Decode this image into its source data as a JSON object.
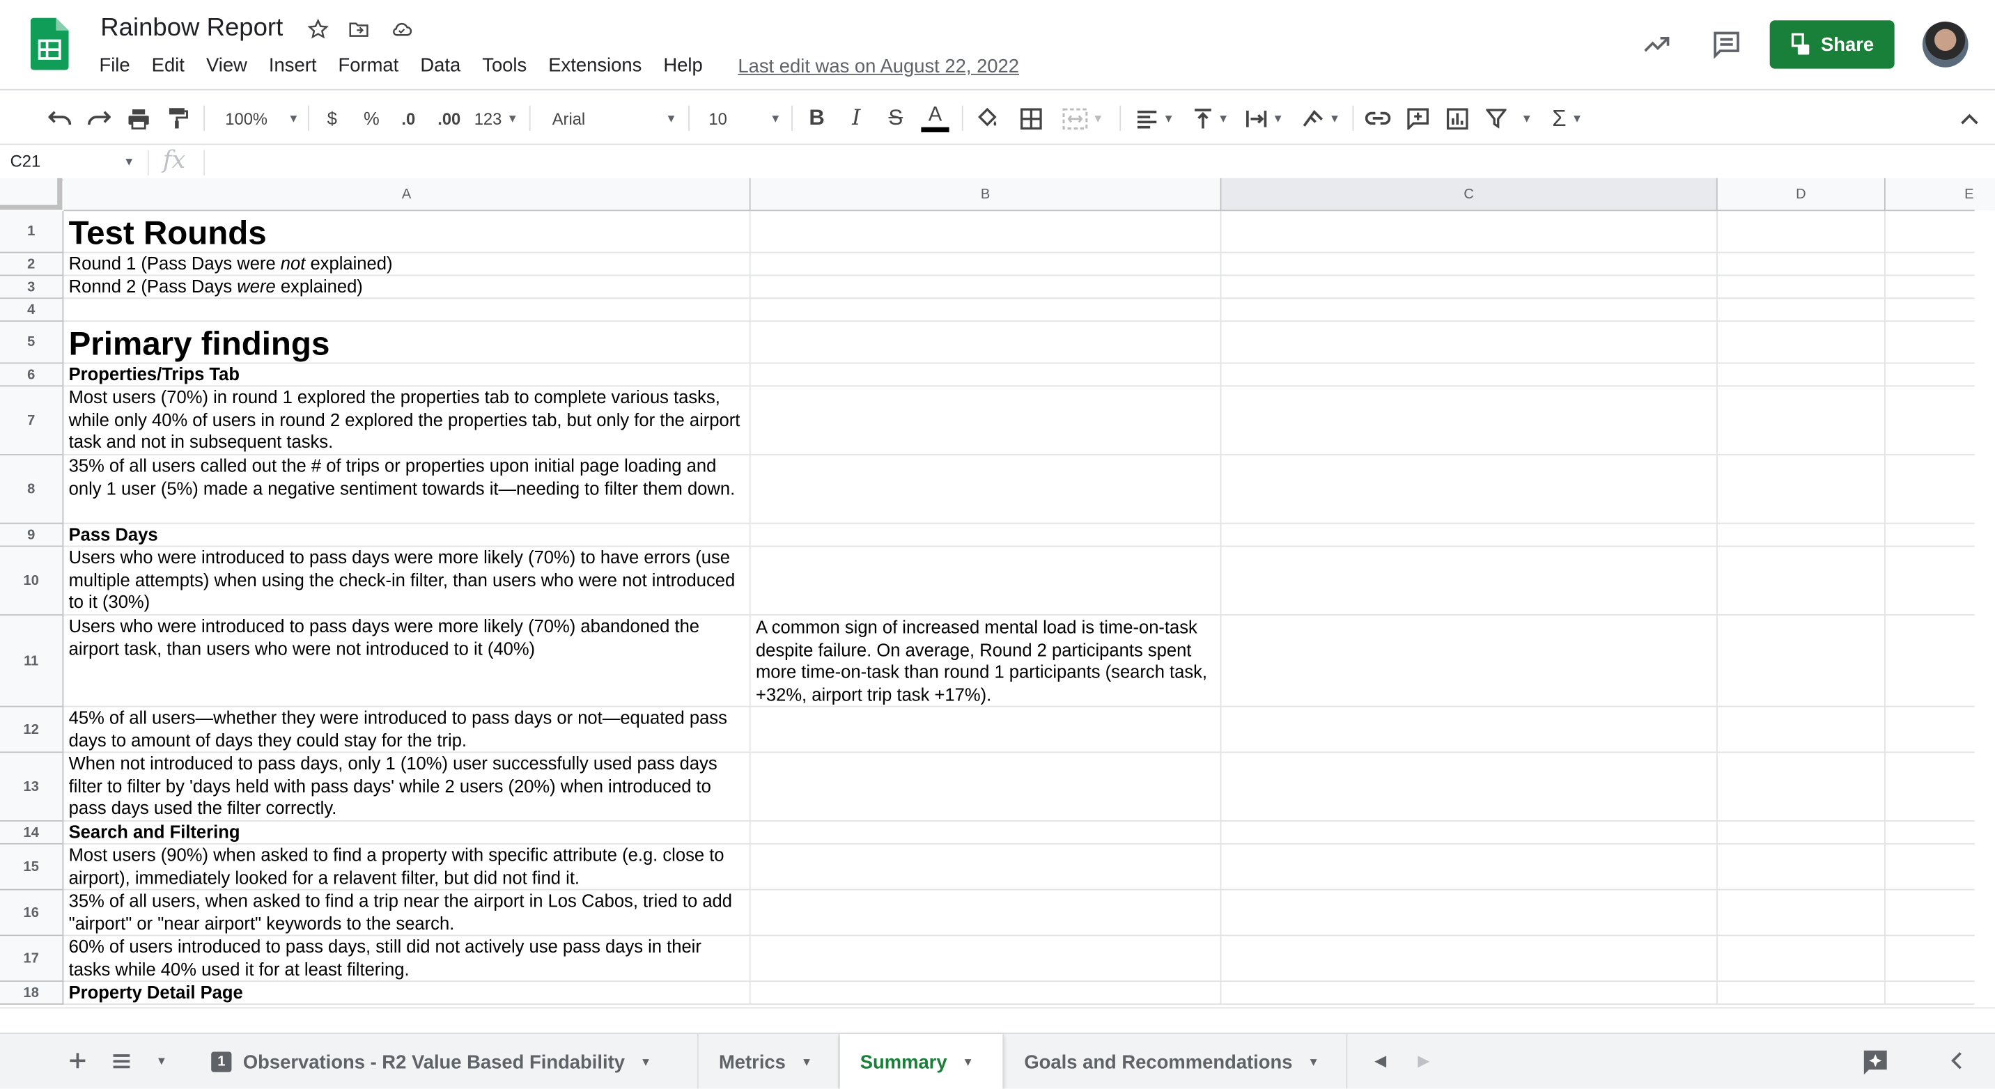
{
  "app": {
    "title": "Rainbow Report",
    "last_edit": "Last edit was on August 22, 2022",
    "share_label": "Share",
    "menu": [
      "File",
      "Edit",
      "View",
      "Insert",
      "Format",
      "Data",
      "Tools",
      "Extensions",
      "Help"
    ]
  },
  "toolbar": {
    "zoom": "100%",
    "currency": "$",
    "percent": "%",
    "dec_decrease": ".0",
    "dec_increase": ".00",
    "more_formats": "123",
    "font": "Arial",
    "font_size": "10",
    "text_color": "#000000"
  },
  "formula_bar": {
    "name_box": "C21",
    "fx": "fx",
    "formula": ""
  },
  "columns": [
    "A",
    "B",
    "C",
    "D",
    "E"
  ],
  "rows": [
    {
      "n": "1",
      "a": "Test Rounds",
      "style": "h1"
    },
    {
      "n": "2",
      "a_parts": [
        "Round 1 (Pass Days were ",
        "not",
        " explained)"
      ]
    },
    {
      "n": "3",
      "a_parts": [
        "Ronnd 2 (Pass Days ",
        "were",
        " explained)"
      ]
    },
    {
      "n": "4",
      "a": ""
    },
    {
      "n": "5",
      "a": "Primary findings",
      "style": "h1"
    },
    {
      "n": "6",
      "a": "Properties/Trips Tab",
      "style": "bold"
    },
    {
      "n": "7",
      "a": "Most users (70%) in round 1 explored the properties tab to complete various tasks, while only 40% of users in round 2 explored the properties tab, but only for the airport task and not in subsequent tasks."
    },
    {
      "n": "8",
      "a": "35% of all users called out the # of trips or properties upon initial page loading and only 1 user (5%) made a negative sentiment towards it—needing to filter them down."
    },
    {
      "n": "9",
      "a": "Pass Days",
      "style": "bold"
    },
    {
      "n": "10",
      "a": "Users who were introduced to pass days were more likely (70%) to have errors (use multiple attempts) when using the check-in filter, than users who were not introduced to it (30%)"
    },
    {
      "n": "11",
      "a": "Users who were introduced to pass days were more likely (70%) abandoned the airport task, than users who were not introduced to it (40%)",
      "b": "A common sign of increased mental load is time-on-task despite failure. On average, Round 2 participants spent more time-on-task than round 1 participants (search task, +32%, airport trip task +17%)."
    },
    {
      "n": "12",
      "a": "45% of all users—whether they were introduced to pass days or not—equated pass days to amount of days they could stay for the trip."
    },
    {
      "n": "13",
      "a": "When not introduced to pass days, only 1 (10%) user successfully used pass days filter to filter by 'days held with pass days' while 2 users (20%) when introduced to pass days used the filter correctly."
    },
    {
      "n": "14",
      "a": "Search and Filtering",
      "style": "bold"
    },
    {
      "n": "15",
      "a": "Most users (90%) when asked to find a property with specific attribute (e.g. close to airport), immediately looked for a relavent filter, but did not find it."
    },
    {
      "n": "16",
      "a": "35% of all users, when asked to find a trip near the airport in Los Cabos, tried to add \"airport\" or \"near airport\" keywords to the search."
    },
    {
      "n": "17",
      "a": "60% of users introduced to pass days, still did not actively use pass days in their tasks while 40% used it for at least filtering."
    },
    {
      "n": "18",
      "a": "Property Detail Page",
      "style": "bold"
    }
  ],
  "sheets": [
    {
      "label": "Observations - R2 Value Based Findability",
      "badge": "1"
    },
    {
      "label": "Metrics"
    },
    {
      "label": "Summary",
      "active": true
    },
    {
      "label": "Goals and Recommendations"
    }
  ]
}
